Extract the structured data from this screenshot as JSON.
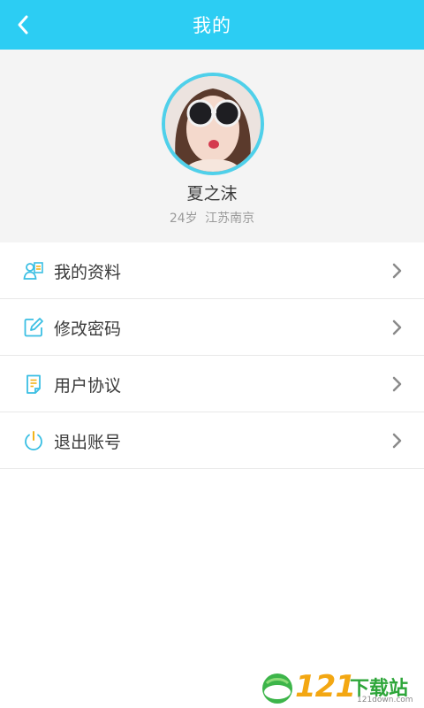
{
  "header": {
    "title": "我的"
  },
  "profile": {
    "name": "夏之沫",
    "info": "24岁 江苏南京"
  },
  "menu": {
    "items": [
      {
        "label": "我的资料",
        "icon": "profile-card-icon"
      },
      {
        "label": "修改密码",
        "icon": "edit-icon"
      },
      {
        "label": "用户协议",
        "icon": "document-icon"
      },
      {
        "label": "退出账号",
        "icon": "power-icon"
      }
    ]
  },
  "watermark": {
    "number": "121",
    "text": "下载站",
    "url": "121down.com"
  },
  "colors": {
    "accent": "#2ccdf3",
    "icon": "#3bbfe3",
    "arrow": "#8a8a8a"
  }
}
